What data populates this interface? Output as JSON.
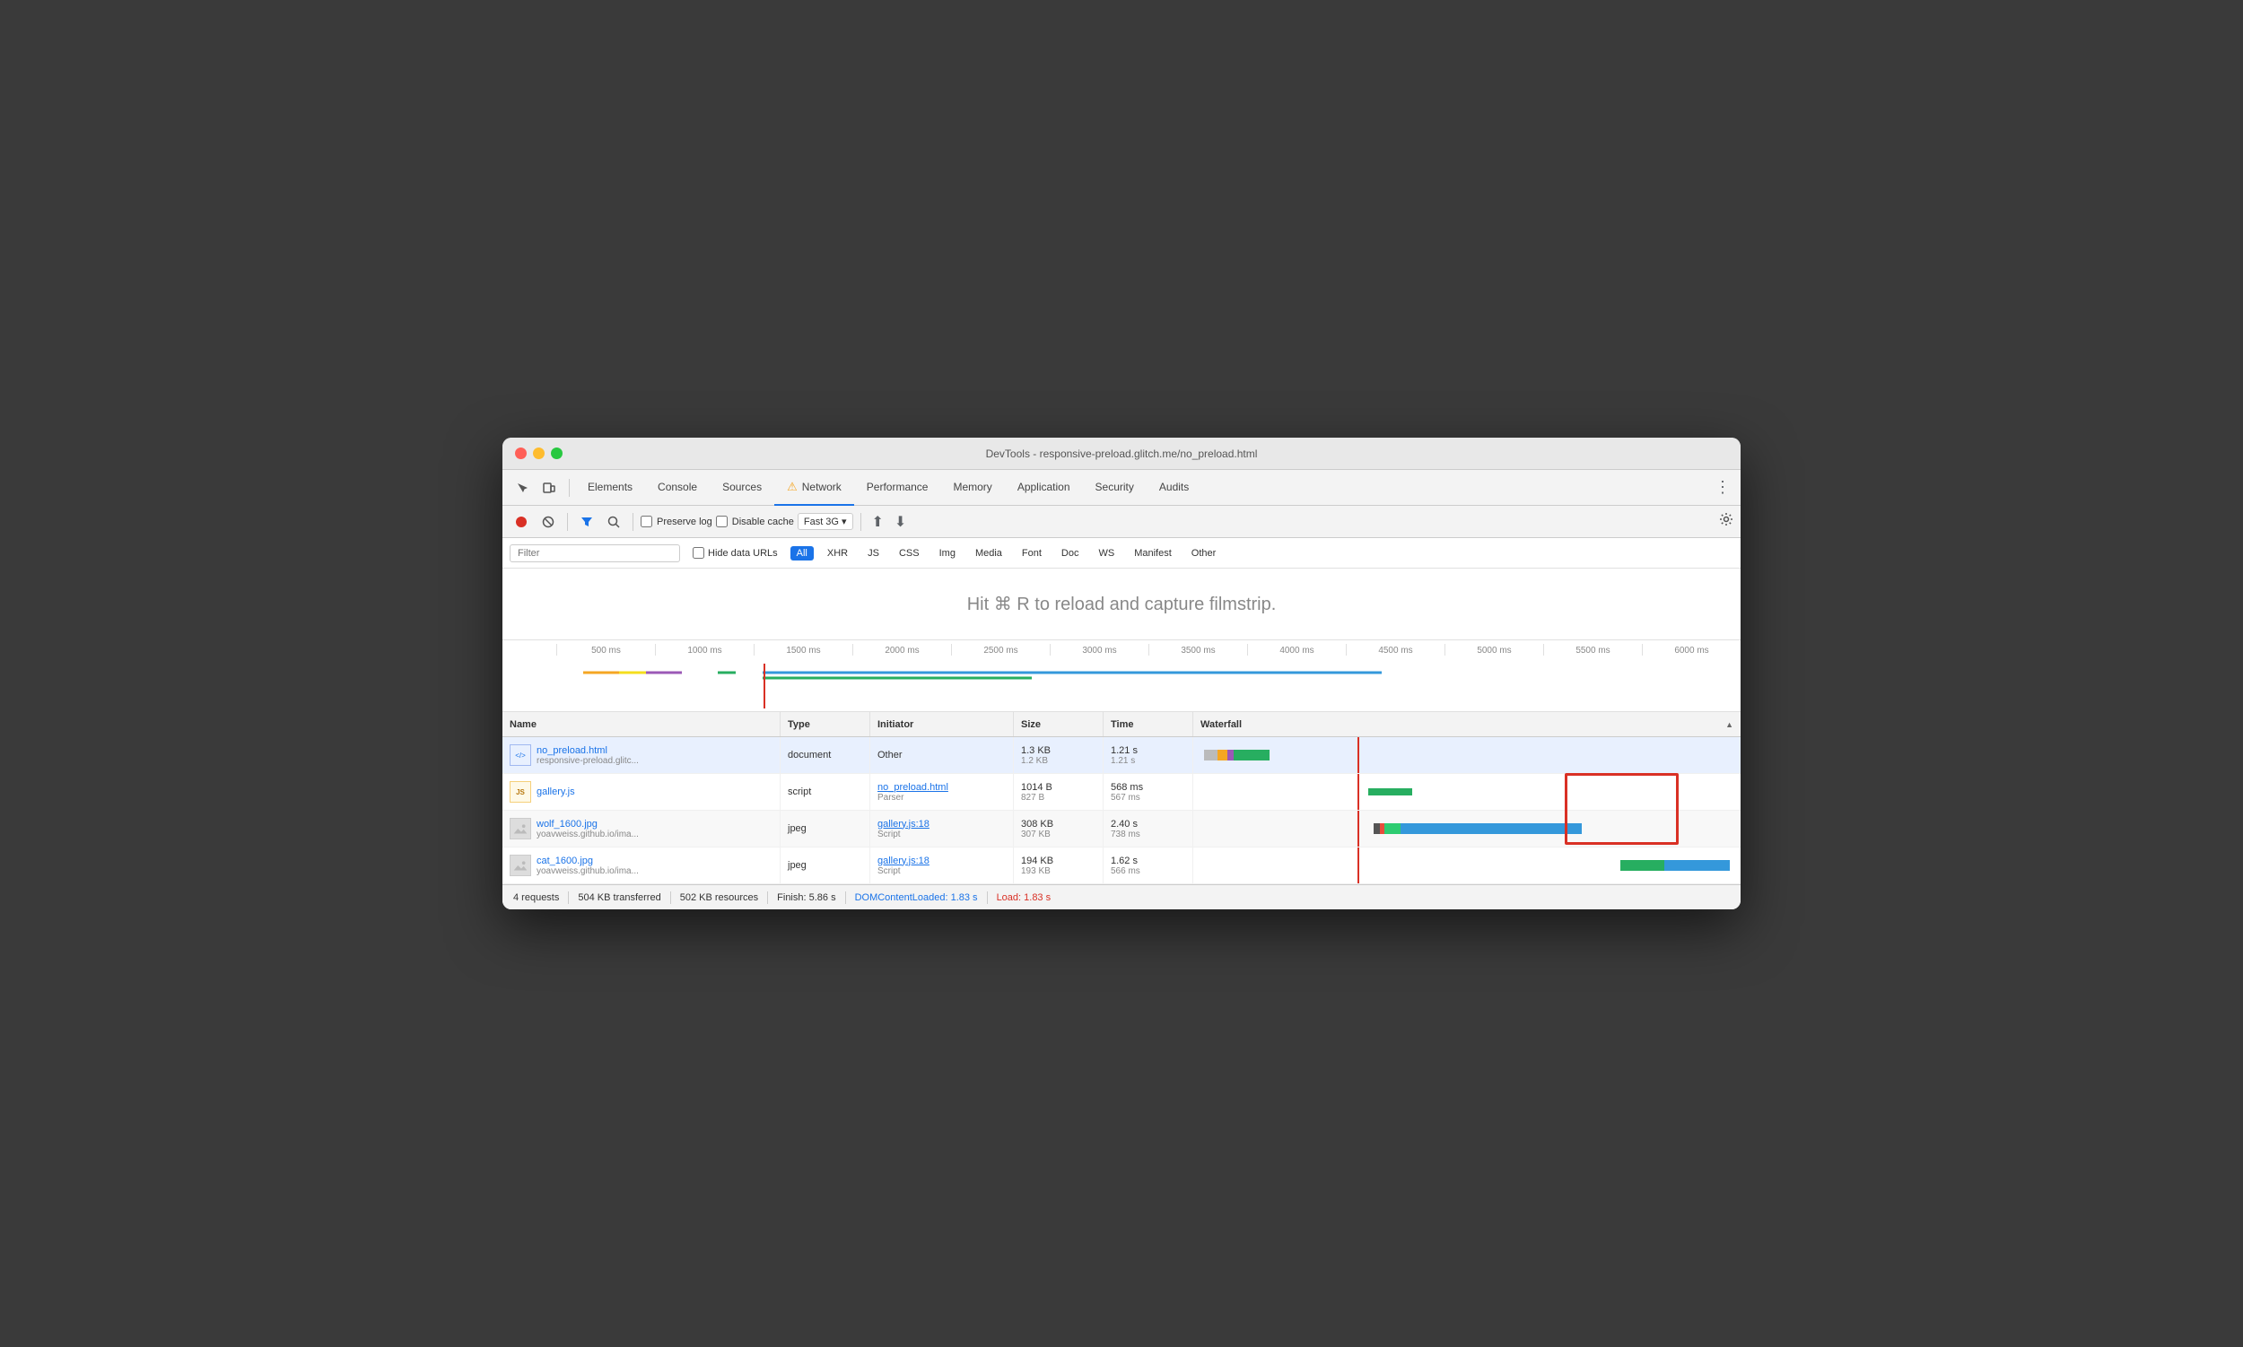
{
  "window": {
    "title": "DevTools - responsive-preload.glitch.me/no_preload.html"
  },
  "tabs": {
    "items": [
      "Elements",
      "Console",
      "Sources",
      "Network",
      "Performance",
      "Memory",
      "Application",
      "Security",
      "Audits"
    ],
    "active": "Network",
    "active_index": 3
  },
  "toolbar": {
    "preserve_log": "Preserve log",
    "disable_cache": "Disable cache",
    "throttle": "Fast 3G"
  },
  "filter": {
    "placeholder": "Filter",
    "hide_data_urls": "Hide data URLs",
    "types": [
      "All",
      "XHR",
      "JS",
      "CSS",
      "Img",
      "Media",
      "Font",
      "Doc",
      "WS",
      "Manifest",
      "Other"
    ],
    "active_type": "All"
  },
  "filmstrip": {
    "message": "Hit ⌘ R to reload and capture filmstrip."
  },
  "ruler": {
    "ticks": [
      "500 ms",
      "1000 ms",
      "1500 ms",
      "2000 ms",
      "2500 ms",
      "3000 ms",
      "3500 ms",
      "4000 ms",
      "4500 ms",
      "5000 ms",
      "5500 ms",
      "6000 ms"
    ]
  },
  "table": {
    "headers": [
      "Name",
      "Type",
      "Initiator",
      "Size",
      "Time",
      "Waterfall"
    ],
    "rows": [
      {
        "name": "no_preload.html",
        "name_sub": "responsive-preload.glitc...",
        "type": "document",
        "initiator_main": "Other",
        "initiator_sub": "",
        "size_top": "1.3 KB",
        "size_bot": "1.2 KB",
        "time_top": "1.21 s",
        "time_bot": "1.21 s",
        "icon": "html",
        "selected": true
      },
      {
        "name": "gallery.js",
        "name_sub": "",
        "type": "script",
        "initiator_main": "no_preload.html",
        "initiator_sub": "Parser",
        "initiator_link": true,
        "size_top": "1014 B",
        "size_bot": "827 B",
        "time_top": "568 ms",
        "time_bot": "567 ms",
        "icon": "js",
        "selected": false
      },
      {
        "name": "wolf_1600.jpg",
        "name_sub": "yoavweiss.github.io/ima...",
        "type": "jpeg",
        "initiator_main": "gallery.js:18",
        "initiator_sub": "Script",
        "initiator_link": true,
        "size_top": "308 KB",
        "size_bot": "307 KB",
        "time_top": "2.40 s",
        "time_bot": "738 ms",
        "icon": "img",
        "selected": false
      },
      {
        "name": "cat_1600.jpg",
        "name_sub": "yoavweiss.github.io/ima...",
        "type": "jpeg",
        "initiator_main": "gallery.js:18",
        "initiator_sub": "Script",
        "initiator_link": true,
        "size_top": "194 KB",
        "size_bot": "193 KB",
        "time_top": "1.62 s",
        "time_bot": "566 ms",
        "icon": "img",
        "selected": false
      }
    ]
  },
  "status": {
    "requests": "4 requests",
    "transferred": "504 KB transferred",
    "resources": "502 KB resources",
    "finish": "Finish: 5.86 s",
    "dom_loaded": "DOMContentLoaded: 1.83 s",
    "load": "Load: 1.83 s"
  }
}
